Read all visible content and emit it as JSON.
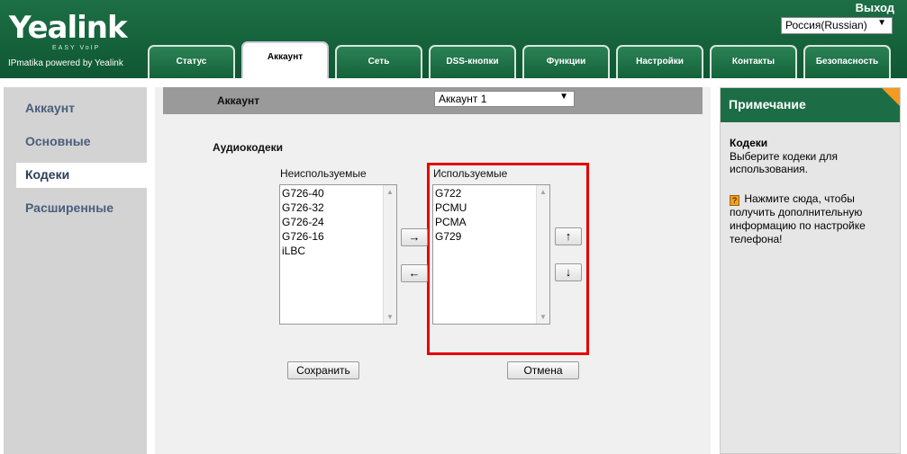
{
  "header": {
    "logo": "Yealink",
    "logo_tag": "EASY VoIP",
    "subtitle": "IPmatika powered by Yealink",
    "logout": "Выход",
    "language": "Россия(Russian)"
  },
  "tabs": [
    {
      "label": "Статус",
      "active": false
    },
    {
      "label": "Аккаунт",
      "active": true
    },
    {
      "label": "Сеть",
      "active": false
    },
    {
      "label": "DSS-кнопки",
      "active": false
    },
    {
      "label": "Функции",
      "active": false
    },
    {
      "label": "Настройки",
      "active": false
    },
    {
      "label": "Контакты",
      "active": false
    },
    {
      "label": "Безопасность",
      "active": false
    }
  ],
  "sidebar": {
    "items": [
      {
        "label": "Аккаунт",
        "active": false
      },
      {
        "label": "Основные",
        "active": false
      },
      {
        "label": "Кодеки",
        "active": true
      },
      {
        "label": "Расширенные",
        "active": false
      }
    ]
  },
  "main": {
    "account_label": "Аккаунт",
    "account_select": "Аккаунт 1",
    "section_title": "Аудиокодеки",
    "unused_label": "Неиспользуемые",
    "unused_codecs": [
      "G726-40",
      "G726-32",
      "G726-24",
      "G726-16",
      "iLBC"
    ],
    "used_label": "Используемые",
    "used_codecs": [
      "G722",
      "PCMU",
      "PCMA",
      "G729"
    ],
    "move_right": "→",
    "move_left": "←",
    "move_up": "↑",
    "move_down": "↓",
    "save": "Сохранить",
    "cancel": "Отмена"
  },
  "note": {
    "header": "Примечание",
    "title": "Кодеки",
    "description": "Выберите кодеки для использования.",
    "help_icon": "?",
    "help_text": "Нажмите сюда, чтобы получить дополнительную информацию по настройке телефона!"
  },
  "colors": {
    "brand_green": "#1c6d45",
    "highlight_red": "#e60000",
    "accent_orange": "#f39a23"
  }
}
